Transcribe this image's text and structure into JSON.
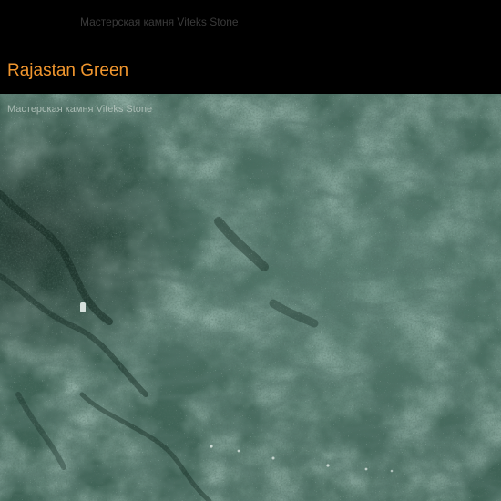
{
  "header": {
    "watermark": "Мастерская камня Viteks Stone",
    "title": "Rajastan Green"
  },
  "image": {
    "watermark": "Мастерская камня Viteks Stone",
    "subject": "green marble texture",
    "colors": {
      "base": "#3f6356",
      "light": "#6f9488",
      "dark": "#1f3a31",
      "speck": "#15241f",
      "highlight": "#a9c2b6"
    }
  },
  "colors": {
    "background": "#000000",
    "title": "#f0962e",
    "watermark": "#3a3a3a"
  }
}
